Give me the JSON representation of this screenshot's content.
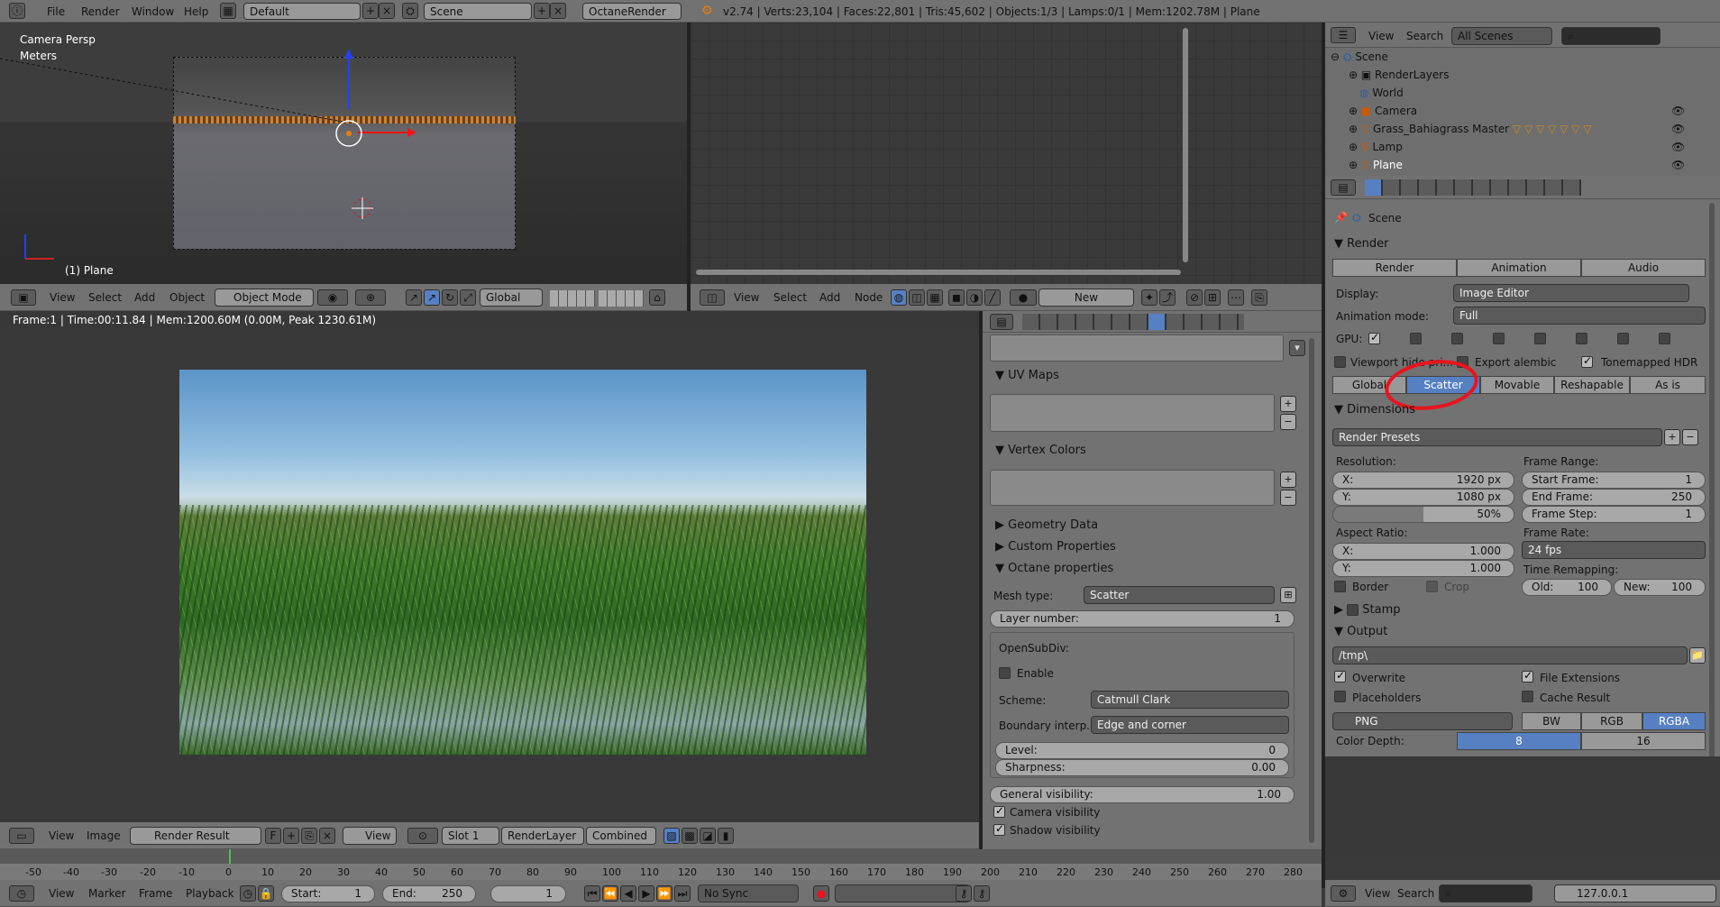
{
  "topbar": {
    "menus": [
      "File",
      "Render",
      "Window",
      "Help"
    ],
    "layout": "Default",
    "scene": "Scene",
    "engine": "OctaneRender",
    "stats": "v2.74 | Verts:23,104 | Faces:22,801 | Tris:45,602 | Objects:1/3 | Lamps:0/1 | Mem:1202.78M | Plane"
  },
  "viewport3d": {
    "view_name": "Camera Persp",
    "units": "Meters",
    "object_label": "(1) Plane",
    "header": {
      "menus": [
        "View",
        "Select",
        "Add",
        "Object"
      ],
      "mode": "Object Mode",
      "orientation": "Global"
    }
  },
  "node_editor": {
    "header": {
      "menus": [
        "View",
        "Select",
        "Add",
        "Node"
      ],
      "new_label": "New"
    }
  },
  "image_editor": {
    "status": "Frame:1 | Time:00:11.84 | Mem:1200.60M (0.00M, Peak 1230.61M)",
    "header": {
      "menus": [
        "View",
        "Image"
      ],
      "image": "Render Result",
      "view": "View",
      "slot": "Slot 1",
      "layer": "RenderLayer",
      "pass": "Combined"
    }
  },
  "mesh_props": {
    "uv_maps": "UV Maps",
    "vertex_colors": "Vertex Colors",
    "geometry_data": "Geometry Data",
    "custom_properties": "Custom Properties",
    "octane_properties": "Octane properties",
    "mesh_type_label": "Mesh type:",
    "mesh_type": "Scatter",
    "layer_number_label": "Layer number:",
    "layer_number": "1",
    "opensubdiv": "OpenSubDiv:",
    "enable": "Enable",
    "scheme_label": "Scheme:",
    "scheme": "Catmull Clark",
    "boundary_label": "Boundary interp.:",
    "boundary": "Edge and corner",
    "level_label": "Level:",
    "level": "0",
    "sharpness_label": "Sharpness:",
    "sharpness": "0.00",
    "gen_vis_label": "General visibility:",
    "gen_vis": "1.00",
    "camera_vis": "Camera visibility",
    "shadow_vis": "Shadow visibility"
  },
  "outliner": {
    "header": {
      "menus": [
        "View",
        "Search"
      ],
      "filter": "All Scenes"
    },
    "items": [
      {
        "label": "Scene"
      },
      {
        "label": "RenderLayers"
      },
      {
        "label": "World"
      },
      {
        "label": "Camera"
      },
      {
        "label": "Grass_Bahiagrass Master"
      },
      {
        "label": "Lamp"
      },
      {
        "label": "Plane"
      }
    ]
  },
  "render_props": {
    "context": "Scene",
    "render_title": "Render",
    "render_btn": "Render",
    "animation_btn": "Animation",
    "audio_btn": "Audio",
    "display_label": "Display:",
    "display": "Image Editor",
    "anim_mode_label": "Animation mode:",
    "anim_mode": "Full",
    "gpu_label": "GPU:",
    "viewport_label": "Viewport hide pri...",
    "export_alembic": "Export alembic",
    "tonemapped": "Tonemapped HDR",
    "tabs": [
      "Global",
      "Scatter",
      "Movable",
      "Reshapable",
      "As is"
    ],
    "selected_tab": "Scatter",
    "dimensions": "Dimensions",
    "render_presets": "Render Presets",
    "resolution_label": "Resolution:",
    "res_x_label": "X:",
    "res_x": "1920 px",
    "res_y_label": "Y:",
    "res_y": "1080 px",
    "res_pct": "50%",
    "frame_range_label": "Frame Range:",
    "start_label": "Start Frame:",
    "start": "1",
    "end_label": "End Frame:",
    "end": "250",
    "step_label": "Frame Step:",
    "step": "1",
    "aspect_label": "Aspect Ratio:",
    "asp_x_label": "X:",
    "asp_x": "1.000",
    "asp_y_label": "Y:",
    "asp_y": "1.000",
    "frame_rate_label": "Frame Rate:",
    "frame_rate": "24 fps",
    "remap_label": "Time Remapping:",
    "old_label": "Old:",
    "old": "100",
    "new_label": "New:",
    "new": "100",
    "border": "Border",
    "crop": "Crop",
    "stamp": "Stamp",
    "output": "Output",
    "path": "/tmp\\",
    "overwrite": "Overwrite",
    "file_ext": "File Extensions",
    "placeholders": "Placeholders",
    "cache": "Cache Result",
    "format": "PNG",
    "bw": "BW",
    "rgb": "RGB",
    "rgba": "RGBA",
    "color_depth_label": "Color Depth:",
    "depth8": "8",
    "depth16": "16"
  },
  "timeline": {
    "ticks": [
      "-50",
      "-40",
      "-30",
      "-20",
      "-10",
      "0",
      "10",
      "20",
      "30",
      "40",
      "50",
      "60",
      "70",
      "80",
      "90",
      "100",
      "110",
      "120",
      "130",
      "140",
      "150",
      "160",
      "170",
      "180",
      "190",
      "200",
      "210",
      "220",
      "230",
      "240",
      "250",
      "260",
      "270",
      "280"
    ],
    "menus": [
      "View",
      "Marker",
      "Frame",
      "Playback"
    ],
    "start_label": "Start:",
    "start": "1",
    "end_label": "End:",
    "end": "250",
    "current": "1",
    "sync": "No Sync"
  },
  "info_footer": {
    "menus": [
      "View",
      "Search"
    ],
    "ip": "127.0.0.1"
  },
  "colors": {
    "accent": "#5680c2",
    "annotation": "#e8141e"
  }
}
